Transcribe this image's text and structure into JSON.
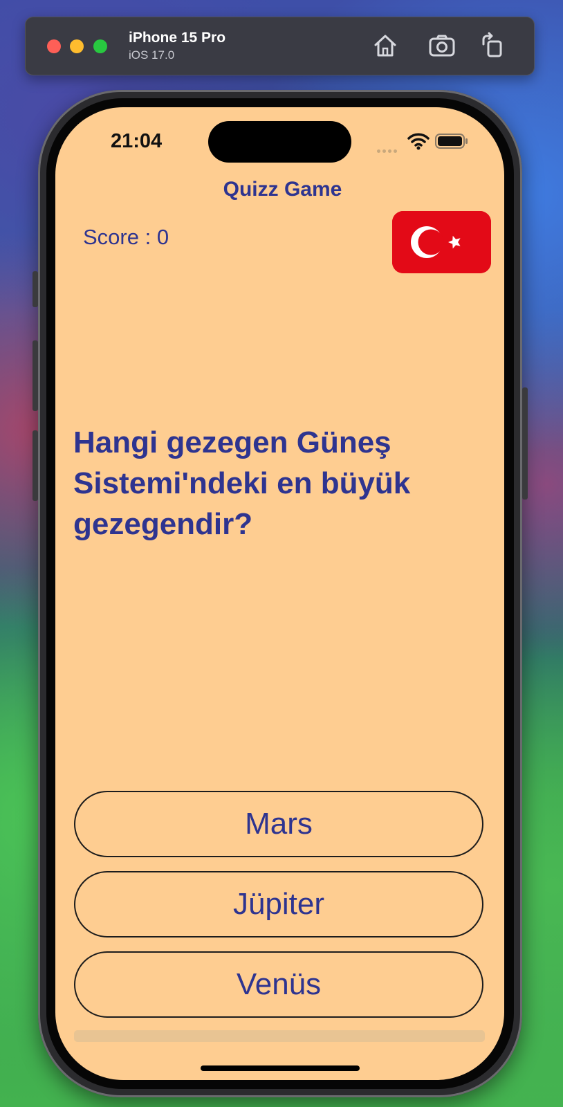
{
  "simulator": {
    "device_name": "iPhone 15 Pro",
    "os_version": "iOS 17.0",
    "toolbar_icons": [
      "home-icon",
      "screenshot-icon",
      "rotate-icon"
    ]
  },
  "status_bar": {
    "time": "21:04",
    "icons": [
      "cellular-signal-icon",
      "wifi-icon",
      "battery-icon"
    ]
  },
  "app": {
    "title": "Quizz Game",
    "score_label": "Score : 0",
    "language_flag": "turkey-flag-icon",
    "question": "Hangi gezegen Güneş Sistemi'ndeki en büyük gezegendir?",
    "answers": [
      {
        "label": "Mars"
      },
      {
        "label": "Jüpiter"
      },
      {
        "label": "Venüs"
      }
    ],
    "progress": 0
  },
  "colors": {
    "screen_background": "#fecd91",
    "text_primary": "#2e3490",
    "flag_red": "#e30a17",
    "button_border": "#1c1c1c"
  }
}
